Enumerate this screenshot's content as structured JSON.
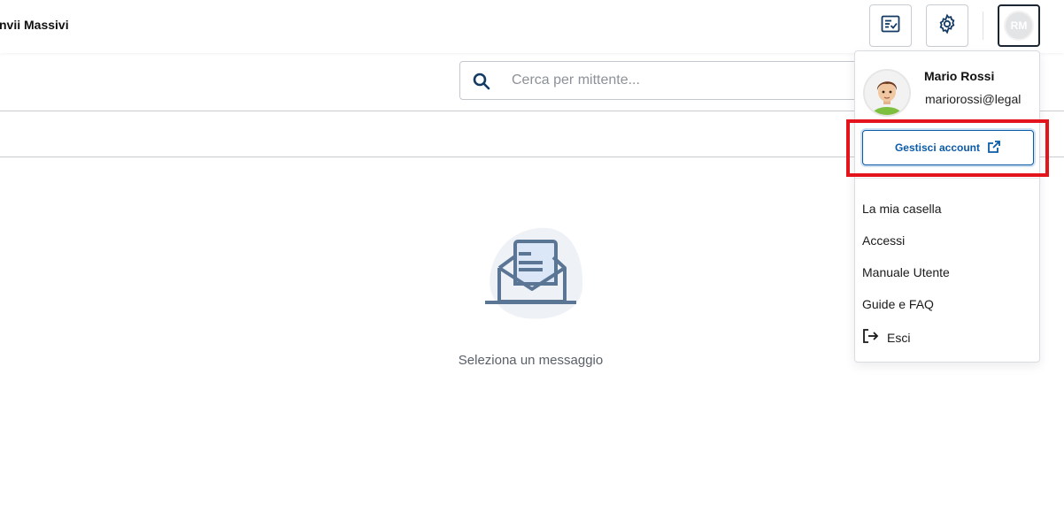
{
  "header": {
    "title": "nvii Massivi",
    "buttons": [
      {
        "name": "checklist-icon"
      },
      {
        "name": "gear-icon"
      }
    ],
    "avatar_initials": "RM"
  },
  "search": {
    "placeholder": "Cerca per mittente..."
  },
  "empty_state": {
    "icon": "open-envelope-icon",
    "text": "Seleziona un messaggio"
  },
  "user_menu": {
    "name": "Mario Rossi",
    "email": "mariorossi@legal",
    "manage_label": "Gestisci account",
    "items": [
      {
        "label": "La mia casella"
      },
      {
        "label": "Accessi"
      },
      {
        "label": "Manuale Utente"
      },
      {
        "label": "Guide e FAQ"
      },
      {
        "label": "Esci",
        "icon": "logout-icon"
      }
    ]
  },
  "colors": {
    "accent": "#0b5ba8",
    "illustration": "#5b7595",
    "highlight": "#e3141c"
  }
}
